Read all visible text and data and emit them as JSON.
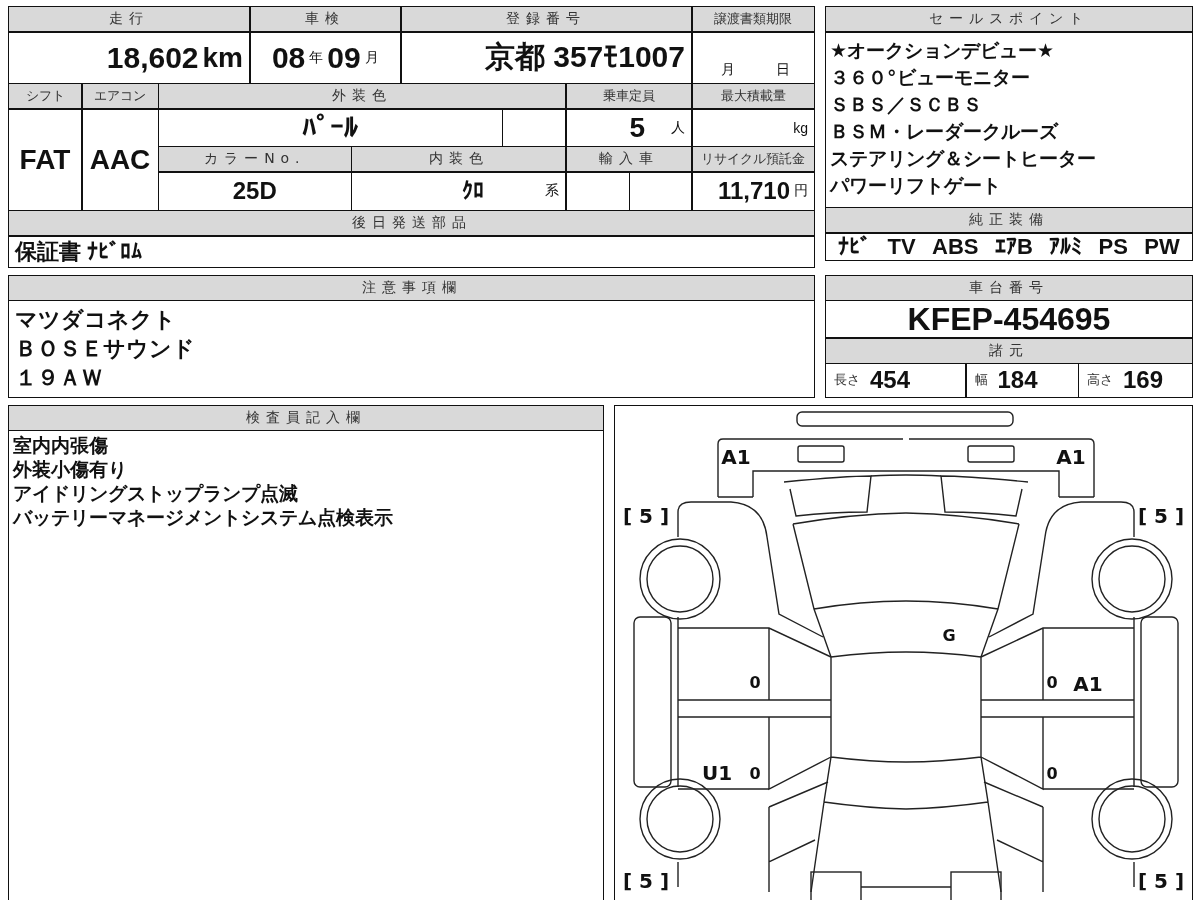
{
  "mileage": {
    "label": "走行",
    "value": "18,602",
    "unit": "km"
  },
  "inspection": {
    "label": "車検",
    "year": "08",
    "year_unit": "年",
    "month": "09",
    "month_unit": "月"
  },
  "registration": {
    "label": "登録番号",
    "value": "京都 357ﾓ1007"
  },
  "transfer_deadline": {
    "label": "譲渡書類期限",
    "month_unit": "月",
    "day_unit": "日"
  },
  "shift": {
    "label": "シフト",
    "value": "FAT"
  },
  "aircon": {
    "label": "エアコン",
    "value": "AAC"
  },
  "exterior_color": {
    "label": "外装色",
    "value": "ﾊﾟｰﾙ"
  },
  "capacity": {
    "label": "乗車定員",
    "value": "5",
    "unit": "人"
  },
  "max_load": {
    "label": "最大積載量",
    "unit": "kg"
  },
  "color_no": {
    "label": "カラーNo.",
    "value": "25D"
  },
  "interior_color": {
    "label": "内装色",
    "value": "ｸﾛ",
    "suffix": "系"
  },
  "import": {
    "label": "輸入車"
  },
  "recycle_fee": {
    "label": "リサイクル預託金",
    "value": "11,710",
    "unit": "円"
  },
  "later_parts": {
    "label": "後日発送部品",
    "value": "保証書 ﾅﾋﾞﾛﾑ"
  },
  "sales_points": {
    "label": "セールスポイント",
    "items": [
      "★オークションデビュー★",
      "３６０°ビューモニター",
      "ＳＢＳ／ＳＣＢＳ",
      "ＢＳＭ・レーダークルーズ",
      "ステアリング＆シートヒーター",
      "パワーリフトゲート"
    ]
  },
  "equipment": {
    "label": "純正装備",
    "items": [
      "ﾅﾋﾞ",
      "TV",
      "ABS",
      "ｴｱB",
      "ｱﾙﾐ",
      "PS",
      "PW"
    ]
  },
  "notes": {
    "label": "注意事項欄",
    "lines": [
      "マツダコネクト",
      "ＢＯＳＥサウンド",
      "１９ＡＷ"
    ]
  },
  "chassis": {
    "label": "車台番号",
    "value": "KFEP-454695"
  },
  "specs": {
    "label": "諸元",
    "items": [
      {
        "label": "長さ",
        "value": "454"
      },
      {
        "label": "幅",
        "value": "184"
      },
      {
        "label": "高さ",
        "value": "169"
      }
    ]
  },
  "inspector": {
    "label": "検査員記入欄",
    "lines": [
      "室内内張傷",
      "外装小傷有り",
      "アイドリングストップランプ点滅",
      "バッテリーマネージメントシステム点検表示"
    ]
  },
  "diagram": {
    "marks": [
      {
        "text": "A1"
      },
      {
        "text": "A1"
      },
      {
        "text": "[ 5 ]"
      },
      {
        "text": "[ 5 ]"
      },
      {
        "text": "G"
      },
      {
        "text": "0"
      },
      {
        "text": "0"
      },
      {
        "text": "A1"
      },
      {
        "text": "U1"
      },
      {
        "text": "0"
      },
      {
        "text": "0"
      },
      {
        "text": "[ 5 ]"
      },
      {
        "text": "[ 5 ]"
      }
    ]
  }
}
